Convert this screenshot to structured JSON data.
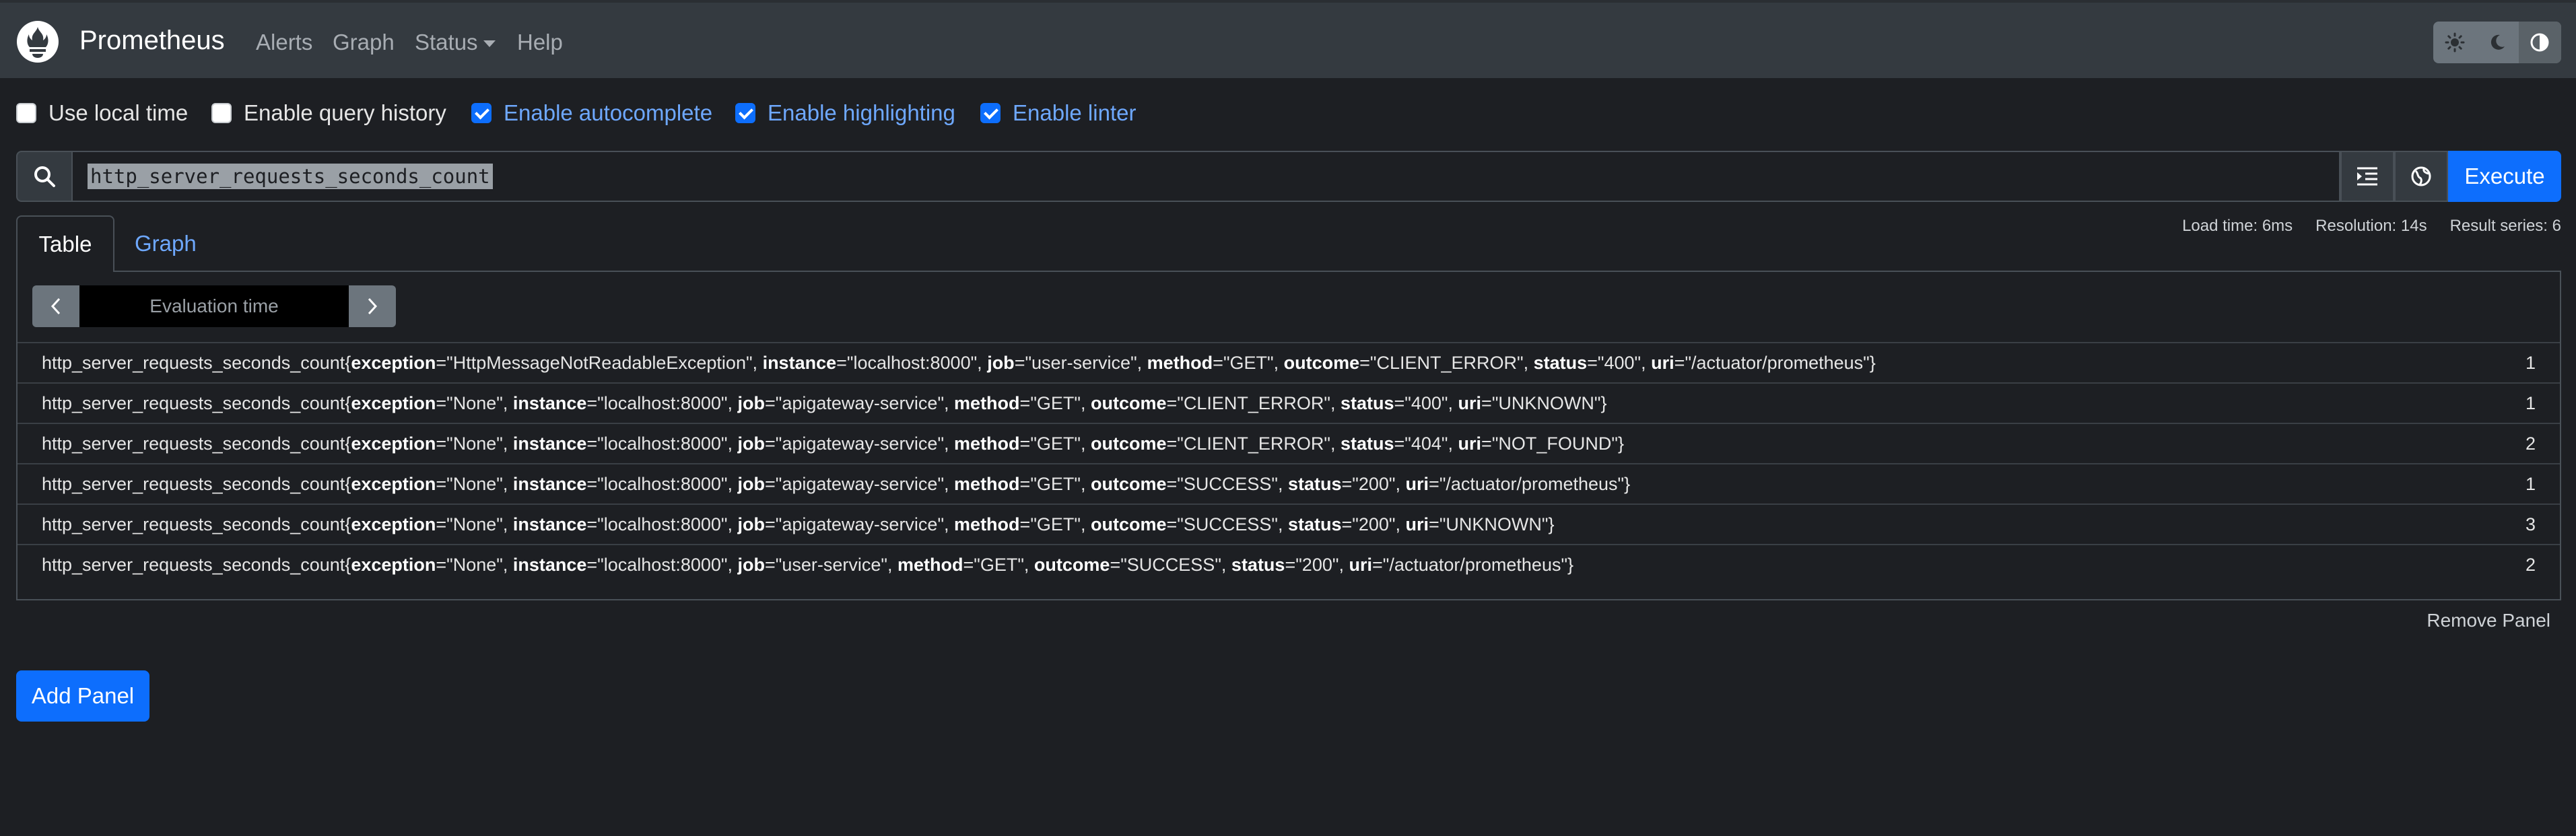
{
  "navbar": {
    "brand": "Prometheus",
    "links": [
      "Alerts",
      "Graph",
      "Status",
      "Help"
    ],
    "theme_icons": [
      "sun-icon",
      "moon-icon",
      "contrast-icon"
    ]
  },
  "options": [
    {
      "label": "Use local time",
      "checked": false
    },
    {
      "label": "Enable query history",
      "checked": false
    },
    {
      "label": "Enable autocomplete",
      "checked": true
    },
    {
      "label": "Enable highlighting",
      "checked": true
    },
    {
      "label": "Enable linter",
      "checked": true
    }
  ],
  "query": {
    "value": "http_server_requests_seconds_count",
    "execute_label": "Execute"
  },
  "stats": {
    "load_time": "Load time: 6ms",
    "resolution": "Resolution: 14s",
    "result_series": "Result series: 6"
  },
  "tabs": {
    "table": "Table",
    "graph": "Graph"
  },
  "evaluation": {
    "placeholder": "Evaluation time"
  },
  "metric_name": "http_server_requests_seconds_count",
  "results": [
    {
      "labels": [
        [
          "exception",
          "HttpMessageNotReadableException"
        ],
        [
          "instance",
          "localhost:8000"
        ],
        [
          "job",
          "user-service"
        ],
        [
          "method",
          "GET"
        ],
        [
          "outcome",
          "CLIENT_ERROR"
        ],
        [
          "status",
          "400"
        ],
        [
          "uri",
          "/actuator/prometheus"
        ]
      ],
      "value": "1"
    },
    {
      "labels": [
        [
          "exception",
          "None"
        ],
        [
          "instance",
          "localhost:8000"
        ],
        [
          "job",
          "apigateway-service"
        ],
        [
          "method",
          "GET"
        ],
        [
          "outcome",
          "CLIENT_ERROR"
        ],
        [
          "status",
          "400"
        ],
        [
          "uri",
          "UNKNOWN"
        ]
      ],
      "value": "1"
    },
    {
      "labels": [
        [
          "exception",
          "None"
        ],
        [
          "instance",
          "localhost:8000"
        ],
        [
          "job",
          "apigateway-service"
        ],
        [
          "method",
          "GET"
        ],
        [
          "outcome",
          "CLIENT_ERROR"
        ],
        [
          "status",
          "404"
        ],
        [
          "uri",
          "NOT_FOUND"
        ]
      ],
      "value": "2"
    },
    {
      "labels": [
        [
          "exception",
          "None"
        ],
        [
          "instance",
          "localhost:8000"
        ],
        [
          "job",
          "apigateway-service"
        ],
        [
          "method",
          "GET"
        ],
        [
          "outcome",
          "SUCCESS"
        ],
        [
          "status",
          "200"
        ],
        [
          "uri",
          "/actuator/prometheus"
        ]
      ],
      "value": "1"
    },
    {
      "labels": [
        [
          "exception",
          "None"
        ],
        [
          "instance",
          "localhost:8000"
        ],
        [
          "job",
          "apigateway-service"
        ],
        [
          "method",
          "GET"
        ],
        [
          "outcome",
          "SUCCESS"
        ],
        [
          "status",
          "200"
        ],
        [
          "uri",
          "UNKNOWN"
        ]
      ],
      "value": "3"
    },
    {
      "labels": [
        [
          "exception",
          "None"
        ],
        [
          "instance",
          "localhost:8000"
        ],
        [
          "job",
          "user-service"
        ],
        [
          "method",
          "GET"
        ],
        [
          "outcome",
          "SUCCESS"
        ],
        [
          "status",
          "200"
        ],
        [
          "uri",
          "/actuator/prometheus"
        ]
      ],
      "value": "2"
    }
  ],
  "footer": {
    "remove_panel": "Remove Panel",
    "add_panel": "Add Panel"
  },
  "colors": {
    "accent": "#0d6efd",
    "link": "#6ea8fe",
    "navbar": "#343a40",
    "background": "#1d1f23"
  }
}
